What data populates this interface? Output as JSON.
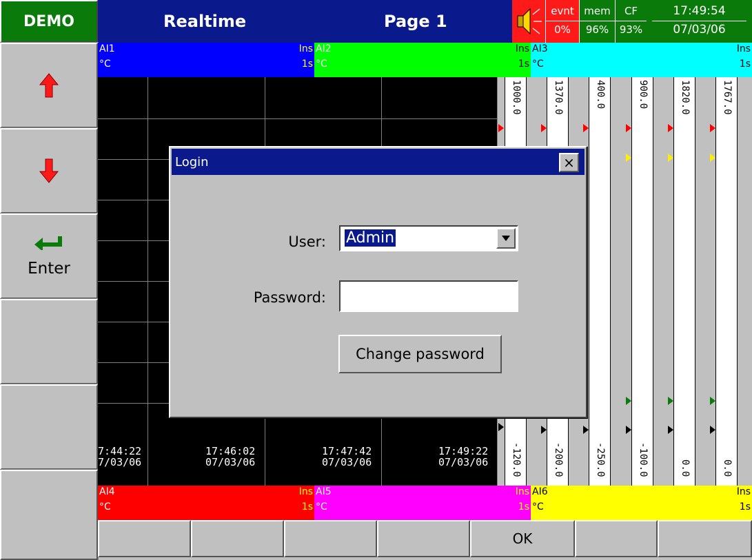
{
  "header": {
    "demo_label": "DEMO",
    "mode": "Realtime",
    "page": "Page 1",
    "evnt_label": "evnt",
    "evnt_value": "0%",
    "mem_label": "mem",
    "mem_value": "96%",
    "cf_label": "CF",
    "cf_value": "93%",
    "time": "17:49:54",
    "date": "07/03/06"
  },
  "sidebar": {
    "up_icon": "arrow-up-icon",
    "down_icon": "arrow-down-icon",
    "enter_icon": "enter-arrow-icon",
    "enter_label": "Enter"
  },
  "channels_top": [
    {
      "name": "AI1",
      "unit": "°C",
      "mode": "Ins",
      "rate": "1s",
      "color": "#0000ff"
    },
    {
      "name": "AI2",
      "unit": "°C",
      "mode": "Ins",
      "rate": "1s",
      "color": "#00ff00"
    },
    {
      "name": "AI3",
      "unit": "°C",
      "mode": "Ins",
      "rate": "1s",
      "color": "#00ffff"
    }
  ],
  "channels_bottom": [
    {
      "name": "AI4",
      "unit": "°C",
      "mode": "Ins",
      "rate": "1s",
      "color": "#ff0000"
    },
    {
      "name": "AI5",
      "unit": "°C",
      "mode": "Ins",
      "rate": "1s",
      "color": "#ff00ff"
    },
    {
      "name": "AI6",
      "unit": "°C",
      "mode": "Ins",
      "rate": "1s",
      "color": "#ffff00"
    }
  ],
  "trend": {
    "time_labels": [
      {
        "time": "7:44:22",
        "date": "7/03/06"
      },
      {
        "time": "17:46:02",
        "date": "07/03/06"
      },
      {
        "time": "17:47:42",
        "date": "07/03/06"
      },
      {
        "time": "17:49:22",
        "date": "07/03/06"
      }
    ]
  },
  "bargraph": {
    "max_labels": [
      "1000.0",
      "1370.0",
      "400.0",
      "900.0",
      "1820.0",
      "1767.0"
    ],
    "min_labels": [
      "-120.0",
      "-200.0",
      "-250.0",
      "-100.0",
      "0.0",
      "0.0"
    ]
  },
  "bottom": {
    "ok_label": "OK"
  },
  "login": {
    "title": "Login",
    "close_label": "×",
    "user_label": "User:",
    "user_value": "Admin",
    "password_label": "Password:",
    "password_value": "",
    "change_password_label": "Change password"
  }
}
